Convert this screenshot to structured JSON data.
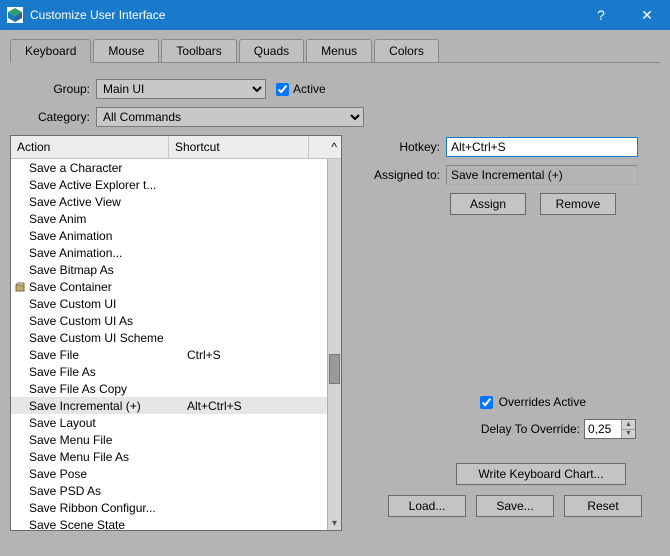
{
  "window": {
    "title": "Customize User Interface",
    "help": "?",
    "close": "✕"
  },
  "tabs": {
    "keyboard": "Keyboard",
    "mouse": "Mouse",
    "toolbars": "Toolbars",
    "quads": "Quads",
    "menus": "Menus",
    "colors": "Colors"
  },
  "labels": {
    "group": "Group:",
    "category": "Category:",
    "active": "Active",
    "hotkey": "Hotkey:",
    "assigned_to": "Assigned to:",
    "overrides_active": "Overrides Active",
    "delay_to_override": "Delay To Override:"
  },
  "values": {
    "group": "Main UI",
    "category": "All Commands",
    "hotkey": "Alt+Ctrl+S",
    "assigned_to": "Save Incremental (+)",
    "active_checked": true,
    "overrides_checked": true,
    "delay": "0,25"
  },
  "buttons": {
    "assign": "Assign",
    "remove": "Remove",
    "write_chart": "Write Keyboard Chart...",
    "load": "Load...",
    "save": "Save...",
    "reset": "Reset"
  },
  "list": {
    "col_action": "Action",
    "col_shortcut": "Shortcut",
    "col_right": "^",
    "scroll_down": "▾",
    "items": [
      {
        "label": "Save a Character",
        "shortcut": "",
        "icon": false,
        "selected": false
      },
      {
        "label": "Save Active Explorer t...",
        "shortcut": "",
        "icon": false,
        "selected": false
      },
      {
        "label": "Save Active View",
        "shortcut": "",
        "icon": false,
        "selected": false
      },
      {
        "label": "Save Anim",
        "shortcut": "",
        "icon": false,
        "selected": false
      },
      {
        "label": "Save Animation",
        "shortcut": "",
        "icon": false,
        "selected": false
      },
      {
        "label": "Save Animation...",
        "shortcut": "",
        "icon": false,
        "selected": false
      },
      {
        "label": "Save Bitmap As",
        "shortcut": "",
        "icon": false,
        "selected": false
      },
      {
        "label": "Save Container",
        "shortcut": "",
        "icon": true,
        "selected": false
      },
      {
        "label": "Save Custom UI",
        "shortcut": "",
        "icon": false,
        "selected": false
      },
      {
        "label": "Save Custom UI As",
        "shortcut": "",
        "icon": false,
        "selected": false
      },
      {
        "label": "Save Custom UI Scheme",
        "shortcut": "",
        "icon": false,
        "selected": false
      },
      {
        "label": "Save File",
        "shortcut": "Ctrl+S",
        "icon": false,
        "selected": false
      },
      {
        "label": "Save File As",
        "shortcut": "",
        "icon": false,
        "selected": false
      },
      {
        "label": "Save File As Copy",
        "shortcut": "",
        "icon": false,
        "selected": false
      },
      {
        "label": "Save Incremental (+)",
        "shortcut": "Alt+Ctrl+S",
        "icon": false,
        "selected": true
      },
      {
        "label": "Save Layout",
        "shortcut": "",
        "icon": false,
        "selected": false
      },
      {
        "label": "Save Menu File",
        "shortcut": "",
        "icon": false,
        "selected": false
      },
      {
        "label": "Save Menu File As",
        "shortcut": "",
        "icon": false,
        "selected": false
      },
      {
        "label": "Save Pose",
        "shortcut": "",
        "icon": false,
        "selected": false
      },
      {
        "label": "Save PSD As",
        "shortcut": "",
        "icon": false,
        "selected": false
      },
      {
        "label": "Save Ribbon Configur...",
        "shortcut": "",
        "icon": false,
        "selected": false
      },
      {
        "label": "Save Scene State",
        "shortcut": "",
        "icon": false,
        "selected": false
      }
    ]
  }
}
